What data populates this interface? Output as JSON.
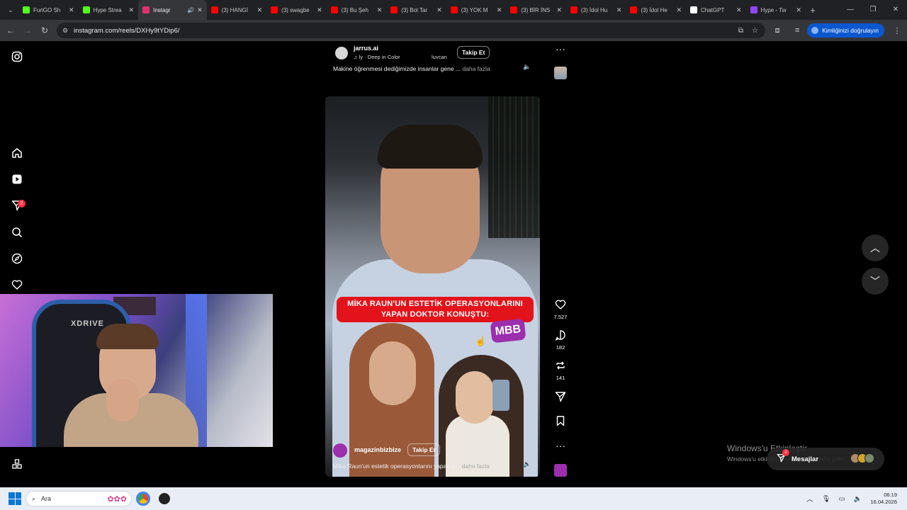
{
  "browser": {
    "tabs": [
      {
        "title": "FuriGO Sh",
        "favicon_color": "#53fc18",
        "active": false
      },
      {
        "title": "Hype Strea",
        "favicon_color": "#53fc18",
        "active": false
      },
      {
        "title": "Instagr",
        "favicon_color": "#e1306c",
        "active": true
      },
      {
        "title": "(3) HANGİ",
        "favicon_color": "#ff0000",
        "active": false
      },
      {
        "title": "(3) swagbe",
        "favicon_color": "#ff0000",
        "active": false
      },
      {
        "title": "(3) Bu Şeh",
        "favicon_color": "#ff0000",
        "active": false
      },
      {
        "title": "(3) Bol Tar",
        "favicon_color": "#ff0000",
        "active": false
      },
      {
        "title": "(3) YOK M",
        "favicon_color": "#ff0000",
        "active": false
      },
      {
        "title": "(3) BİR İNS",
        "favicon_color": "#ff0000",
        "active": false
      },
      {
        "title": "(3) İdol Hu",
        "favicon_color": "#ff0000",
        "active": false
      },
      {
        "title": "(3) İdol He",
        "favicon_color": "#ff0000",
        "active": false
      },
      {
        "title": "ChatGPT",
        "favicon_color": "#ffffff",
        "active": false
      },
      {
        "title": "Hype - Tw",
        "favicon_color": "#9146ff",
        "active": false
      }
    ],
    "url": "instagram.com/reels/DXHy9tYDip6/",
    "verify_label": "Kimliğinizi doğrulayın"
  },
  "sidebar": {
    "notification_count": "2"
  },
  "reel_previous": {
    "username": "jarrus.ai",
    "music_a": "ly · Deep in Color",
    "music_b": "luvcan",
    "follow_label": "Takip Et",
    "caption": "Makine öğrenmesi dediğimizde insanlar gene ...",
    "more_label": "daha fazla"
  },
  "reel_current": {
    "banner_line1": "MİKA RAUN'UN ESTETİK OPERASYONLARINI",
    "banner_line2": "YAPAN DOKTOR KONUŞTU:",
    "logo_text": "MBB",
    "username": "magazinbizbize",
    "follow_label": "Takip Et",
    "caption": "Mika Raun'un estetik operasyonlarını yapan d...",
    "more_label": "daha fazla"
  },
  "actions": {
    "likes": "7.527",
    "comments": "182",
    "reposts": "141"
  },
  "webcam": {
    "chair_brand": "XDRIVE"
  },
  "overlay": {
    "activate_title": "Windows'u Etkinleştir",
    "activate_sub": "Windows'u etkinleştirmek için Ayarlar'a gidin.",
    "messages_label": "Mesajlar",
    "messages_badge": "2"
  },
  "taskbar": {
    "search_placeholder": "Ara",
    "time": "06:19",
    "date": "16.04.2026"
  }
}
